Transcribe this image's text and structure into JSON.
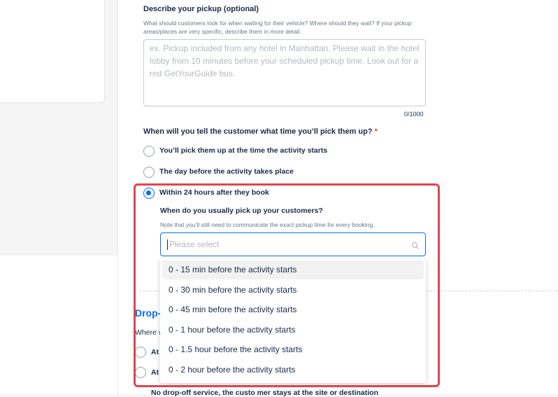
{
  "pickup_description": {
    "label": "Describe your pickup (optional)",
    "hint": "What should customers look for when waiting for their vehicle? Where should they wait? If your pickup areas/places are very specific, describe them in more detail.",
    "placeholder": "ex. Pickup included from any hotel in Manhattan. Please wait in the hotel lobby from 10 minutes before your scheduled pickup time. Look out for a red GetYourGuide bus.",
    "counter": "0/1000"
  },
  "pickup_time_question": {
    "label": "When will you tell the customer what time you’ll pick them up?",
    "required_mark": "*",
    "options": [
      {
        "label": "You’ll pick them up at the time the activity starts",
        "checked": false
      },
      {
        "label": "The day before the activity takes place",
        "checked": false
      },
      {
        "label": "Within 24 hours after they book",
        "checked": true
      }
    ]
  },
  "usual_pickup": {
    "label": "When do you usually pick up your customers?",
    "hint": "Note that you’ll still need to communicate the exact pickup time for every booking.",
    "select_placeholder": "Please select",
    "options": [
      "0 - 15 min before the activity starts",
      "0 - 30 min before the activity starts",
      "0 - 45 min before the activity starts",
      "0 - 1 hour before the activity starts",
      "0 - 1.5 hour before the activity starts",
      "0 - 2 hour before the activity starts"
    ]
  },
  "dropoff": {
    "title_partial": "Drop-",
    "question_partial": "Where w",
    "option_1_partial": "At",
    "option_2_partial": "At",
    "option_3_partial": "No drop-off service, the custo mer stays at the site or destination"
  },
  "colors": {
    "accent": "#0071eb",
    "highlight": "#e4434a"
  }
}
